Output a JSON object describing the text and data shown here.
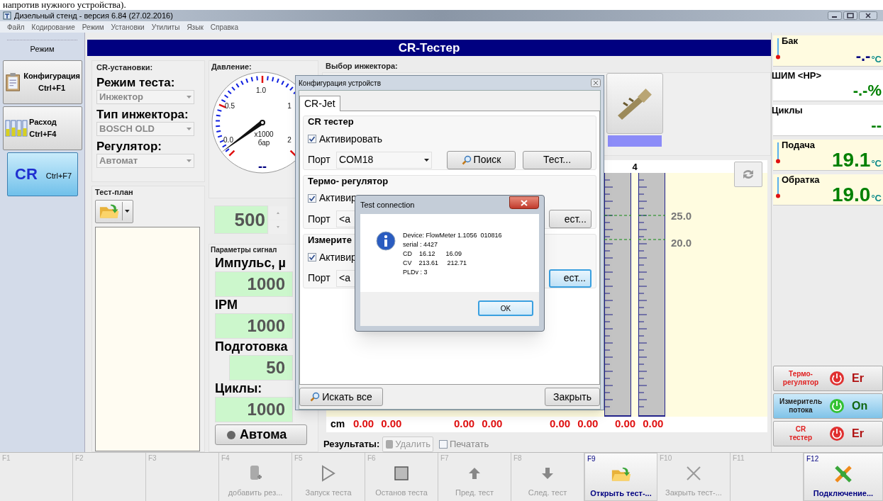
{
  "document_text": "напротив нужного устройства).",
  "window": {
    "title": "Дизельный стенд - версия 6.84 (27.02.2016)",
    "menu": [
      "Файл",
      "Кодирование",
      "Режим",
      "Установки",
      "Утилиты",
      "Язык",
      "Справка"
    ]
  },
  "sidebar": {
    "header": "Режим",
    "items": [
      {
        "label": "Конфигурация",
        "shortcut": "Ctrl+F1",
        "kind": "config",
        "selected": false
      },
      {
        "label": "Расход",
        "shortcut": "Ctrl+F4",
        "kind": "flow",
        "selected": false
      },
      {
        "label": "CR",
        "shortcut": "Ctrl+F7",
        "kind": "cr",
        "selected": true
      }
    ]
  },
  "header": "CR-Тестер",
  "cr_settings": {
    "title": "CR-установки:",
    "fields": [
      {
        "label": "Режим теста:",
        "value": "Инжектор"
      },
      {
        "label": "Тип инжектора:",
        "value": "BOSCH OLD"
      },
      {
        "label": "Регулятор:",
        "value": "Автомат"
      }
    ],
    "test_plan": "Тест-план"
  },
  "pressure": {
    "title": "Давление:",
    "scale_labels": [
      "1.0",
      "0.5",
      "0.0",
      "1",
      "2"
    ],
    "unit": "x1000",
    "unit_name": "бар",
    "reading": "--",
    "setpoint": "500"
  },
  "signal": {
    "title": "Параметры сигнал",
    "fields": [
      {
        "label": "Импульс, µ",
        "value": "1000"
      },
      {
        "label": "IPM",
        "value": "1000"
      },
      {
        "label": "Подготовка",
        "value": "50"
      },
      {
        "label": "Циклы:",
        "value": "1000"
      }
    ],
    "auto_button": "Автома"
  },
  "injectors": {
    "title": "Выбор инжектора:"
  },
  "chart": {
    "column_label": "4",
    "scale_labels": [
      "25.0",
      "20.0"
    ],
    "unit": "cm",
    "values": [
      [
        "0.00",
        "0.00"
      ],
      [
        "0.00",
        "0.00"
      ],
      [
        "0.00",
        "0.00"
      ],
      [
        "0.00",
        "0.00"
      ]
    ]
  },
  "results": {
    "label": "Результаты:",
    "delete_button": {
      "label": "Удалить",
      "disabled": true
    },
    "print": {
      "label": "Печатать",
      "checked": false
    }
  },
  "readings": [
    {
      "label": "Бак",
      "value": "-.-",
      "unit": "°C",
      "kind": "temperature",
      "color": "#000080"
    },
    {
      "label": "ШИМ <HP>",
      "value": "-.-%",
      "kind": "plain",
      "color": "#008000"
    },
    {
      "label": "Циклы",
      "value": "--",
      "kind": "plain",
      "color": "#008000"
    },
    {
      "label": "Подача",
      "value": "19.1",
      "unit": "°C",
      "kind": "temperature",
      "color": "#008000"
    },
    {
      "label": "Обратка",
      "value": "19.0",
      "unit": "°C",
      "kind": "temperature",
      "color": "#008000"
    }
  ],
  "statuses": [
    {
      "lines": [
        "Термо-",
        "регулятор"
      ],
      "state": "Er",
      "on": false
    },
    {
      "lines": [
        "Измеритель",
        "потока"
      ],
      "state": "On",
      "on": true
    },
    {
      "lines": [
        "CR",
        "тестер"
      ],
      "state": "Er",
      "on": false
    }
  ],
  "config_dialog": {
    "title": "Конфигурация устройств",
    "tabs": [
      {
        "label": "CR-Jet",
        "selected": true
      }
    ],
    "groups": [
      {
        "title": "CR тестер",
        "activate": {
          "label": "Активировать",
          "checked": true
        },
        "port_label": "Порт",
        "port": "COM18",
        "search_button": "Поиск",
        "test_button": "Тест...",
        "focused": false
      },
      {
        "title": "Термо- регулятор",
        "activate": {
          "label": "Активир",
          "checked": true
        },
        "port_label": "Порт",
        "port": "<a",
        "test_button": "ест...",
        "focused": false
      },
      {
        "title": "Измерите",
        "activate": {
          "label": "Активир",
          "checked": true
        },
        "port_label": "Порт",
        "port": "<a",
        "test_button": "ест...",
        "focused": true
      }
    ],
    "search_all": "Искать все",
    "close": "Закрыть"
  },
  "test_dialog": {
    "title": "Test connection",
    "lines": [
      "Device: FlowMeter 1.1056  010816",
      "serial : 4427",
      "CD    16.12      16.09",
      "CV    213.61     212.71",
      "PLDv : 3"
    ],
    "ok": "OK"
  },
  "fkeys": [
    {
      "key": "F1",
      "disabled": true
    },
    {
      "key": "F2",
      "disabled": true
    },
    {
      "key": "F3",
      "disabled": true
    },
    {
      "key": "F4",
      "label": "добавить рез...",
      "kind": "db-add",
      "disabled": true
    },
    {
      "key": "F5",
      "label": "Запуск теста",
      "kind": "play",
      "disabled": true
    },
    {
      "key": "F6",
      "label": "Останов теста",
      "kind": "stop",
      "disabled": true
    },
    {
      "key": "F7",
      "label": "Пред. тест",
      "kind": "up",
      "disabled": true
    },
    {
      "key": "F8",
      "label": "След. тест",
      "kind": "down",
      "disabled": true
    },
    {
      "key": "F9",
      "label": "Открыть тест-...",
      "kind": "folder",
      "disabled": false
    },
    {
      "key": "F10",
      "label": "Закрыть тест-...",
      "kind": "close",
      "disabled": true
    },
    {
      "key": "F11",
      "disabled": true
    },
    {
      "key": "F12",
      "label": "Подключение...",
      "kind": "plug",
      "disabled": false
    }
  ]
}
